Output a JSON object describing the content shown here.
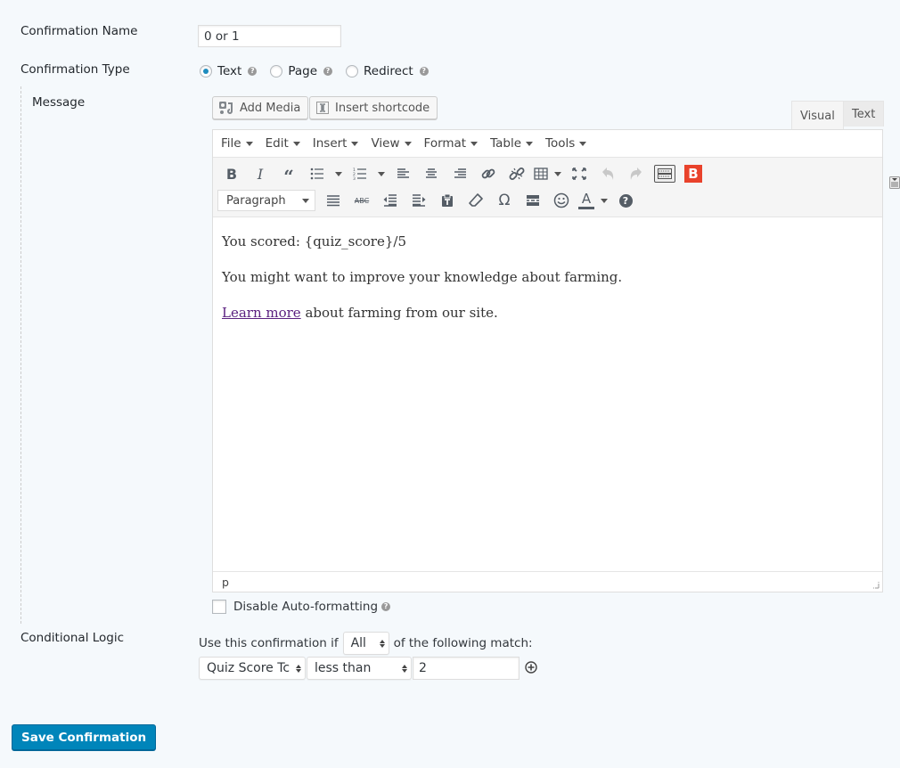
{
  "confirmation_name": {
    "label": "Confirmation Name",
    "value": "0 or 1"
  },
  "confirmation_type": {
    "label": "Confirmation Type",
    "options": [
      {
        "label": "Text",
        "selected": true
      },
      {
        "label": "Page",
        "selected": false
      },
      {
        "label": "Redirect",
        "selected": false
      }
    ]
  },
  "message": {
    "label": "Message",
    "add_media_label": "Add Media",
    "insert_shortcode_label": "Insert shortcode",
    "tabs": [
      {
        "label": "Visual",
        "active": true
      },
      {
        "label": "Text",
        "active": false
      }
    ],
    "menubar": [
      "File",
      "Edit",
      "Insert",
      "View",
      "Format",
      "Table",
      "Tools"
    ],
    "toolbar1_icons": [
      "bold-icon",
      "italic-icon",
      "blockquote-icon",
      "bullet-list-icon",
      "numbered-list-icon",
      "align-left-icon",
      "align-center-icon",
      "align-right-icon",
      "link-icon",
      "unlink-icon",
      "table-icon",
      "fullscreen-icon",
      "undo-icon",
      "redo-icon",
      "toolbar-toggle-icon",
      "bootstrap-icon"
    ],
    "toolbar2_icons": [
      "justify-icon",
      "strikethrough-icon",
      "outdent-icon",
      "indent-icon",
      "paste-text-icon",
      "clear-formatting-icon",
      "special-character-icon",
      "read-more-icon",
      "emoticon-icon",
      "text-color-icon",
      "help-icon"
    ],
    "format_select": "Paragraph",
    "content": {
      "line1": "You scored: {quiz_score}/5",
      "line2": "You might want to improve your knowledge about farming.",
      "line3_link": "Learn more",
      "line3_rest": " about farming from our site."
    },
    "status_path": "p",
    "disable_autoformat_label": "Disable Auto-formatting",
    "disable_autoformat_checked": false
  },
  "conditional_logic": {
    "label": "Conditional Logic",
    "prefix": "Use this confirmation if",
    "match_select": "All",
    "suffix": "of the following match:",
    "rule": {
      "field": "Quiz Score Tc",
      "operator": "less than",
      "value": "2"
    }
  },
  "save_button_label": "Save Confirmation",
  "colors": {
    "primary": "#0085ba",
    "link": "#5b2180",
    "bootstrap_red": "#e9422b"
  }
}
